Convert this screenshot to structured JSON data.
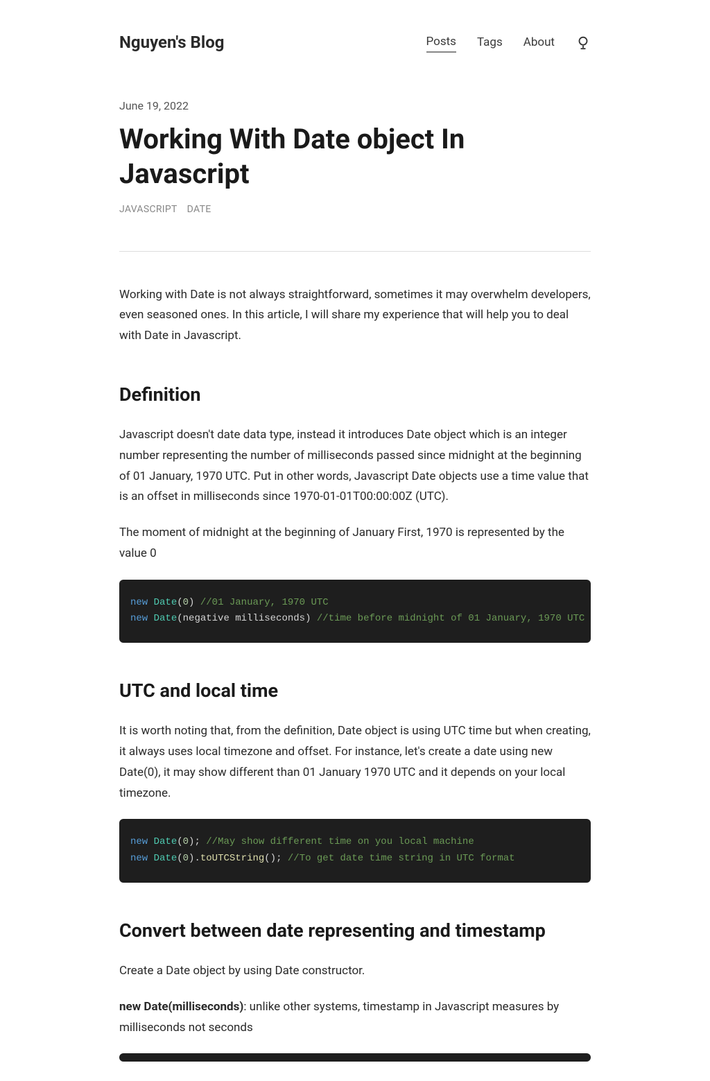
{
  "header": {
    "site_title": "Nguyen's Blog",
    "nav": {
      "posts": "Posts",
      "tags": "Tags",
      "about": "About"
    }
  },
  "post": {
    "date": "June 19, 2022",
    "title": "Working With Date object In Javascript",
    "tags": {
      "javascript": "JAVASCRIPT",
      "date": "DATE"
    },
    "intro": "Working with Date is not always straightforward, sometimes it may overwhelm developers, even seasoned ones. In this article, I will share my experience that will help you to deal with Date in Javascript.",
    "sections": {
      "definition": {
        "heading": "Definition",
        "p1": "Javascript doesn't date data type, instead it introduces Date object which is an integer number representing the number of milliseconds passed since midnight at the beginning of 01 January, 1970 UTC. Put in other words, Javascript Date objects use a time value that is an offset in milliseconds since 1970-01-01T00:00:00Z (UTC).",
        "p2": "The moment of midnight at the beginning of January First, 1970 is represented by the value 0"
      },
      "utc": {
        "heading": "UTC and local time",
        "p1": "It is worth noting that, from the definition, Date object is using UTC time but when creating, it always uses local timezone and offset. For instance, let's create a date using new Date(0), it may show different than 01 January 1970 UTC and it depends on your local timezone."
      },
      "convert": {
        "heading": "Convert between date representing and timestamp",
        "p1": "Create a Date object by using Date constructor.",
        "p2_strong": "new Date(milliseconds)",
        "p2_rest": ": unlike other systems, timestamp in Javascript measures by milliseconds not seconds"
      }
    },
    "code": {
      "block1": {
        "l1_kw": "new",
        "l1_cls": "Date",
        "l1_open": "(",
        "l1_num": "0",
        "l1_close": ") ",
        "l1_cmt": "//01 January, 1970 UTC",
        "l2_kw": "new",
        "l2_cls": "Date",
        "l2_args": "(negative milliseconds) ",
        "l2_cmt": "//time before midnight of 01 January, 1970 UTC"
      },
      "block2": {
        "l1_kw": "new",
        "l1_cls": "Date",
        "l1_open": "(",
        "l1_num": "0",
        "l1_close": "); ",
        "l1_cmt": "//May show different time on you local machine",
        "l2_kw": "new",
        "l2_cls": "Date",
        "l2_open": "(",
        "l2_num": "0",
        "l2_mid": ").",
        "l2_fn": "toUTCString",
        "l2_close": "(); ",
        "l2_cmt": "//To get date time string in UTC format"
      }
    }
  }
}
